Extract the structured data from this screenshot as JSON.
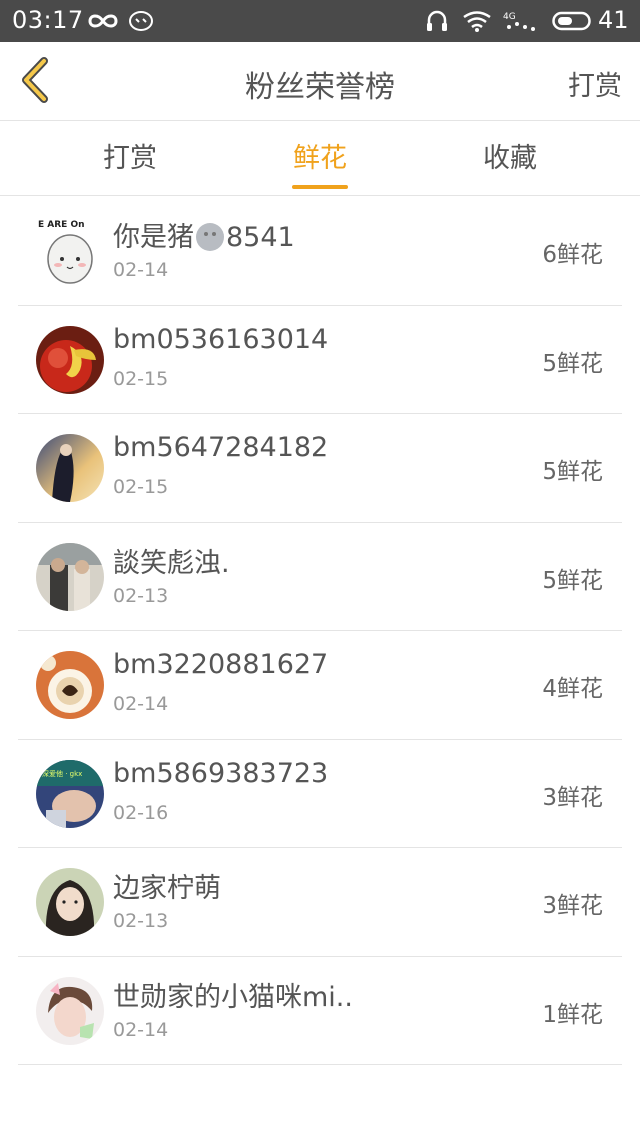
{
  "status_bar": {
    "time": "03:17",
    "battery": "41",
    "icons": [
      "infinity-icon",
      "notification-icon",
      "headphones-icon",
      "wifi-icon",
      "signal-4g-icon",
      "battery-toggle-icon"
    ]
  },
  "header": {
    "back_icon": "chevron-left-icon",
    "title": "粉丝荣誉榜",
    "action_label": "打赏"
  },
  "tabs": [
    {
      "label": "打赏",
      "active": false
    },
    {
      "label": "鲜花",
      "active": true
    },
    {
      "label": "收藏",
      "active": false
    }
  ],
  "accent_color": "#f0a21c",
  "fans": [
    {
      "name_prefix": "你是猪",
      "name_suffix": "8541",
      "emoji": "gray-face-emoji",
      "date": "02-14",
      "count": "6鲜花",
      "avatar_text": "E ARE On"
    },
    {
      "name": "bm0536163014",
      "date": "02-15",
      "count": "5鲜花"
    },
    {
      "name": "bm5647284182",
      "date": "02-15",
      "count": "5鲜花"
    },
    {
      "name": "談笑彪浊.",
      "date": "02-13",
      "count": "5鲜花"
    },
    {
      "name": "bm3220881627",
      "date": "02-14",
      "count": "4鲜花"
    },
    {
      "name": "bm5869383723",
      "date": "02-16",
      "count": "3鲜花",
      "avatar_text": "深爱他 · gkx"
    },
    {
      "name": "边家柠萌",
      "date": "02-13",
      "count": "3鲜花"
    },
    {
      "name": "世勋家的小猫咪mi..",
      "date": "02-14",
      "count": "1鲜花"
    }
  ]
}
